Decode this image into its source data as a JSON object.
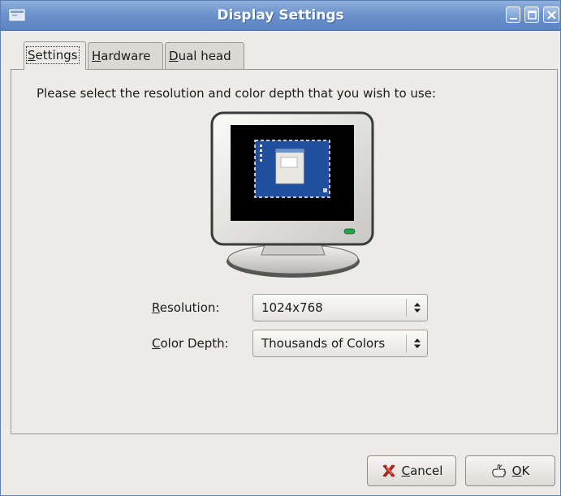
{
  "window": {
    "title": "Display Settings"
  },
  "tabs": [
    {
      "label": "Settings",
      "mnemonic": "S",
      "rest": "ettings",
      "active": true
    },
    {
      "label": "Hardware",
      "mnemonic": "H",
      "rest": "ardware",
      "active": false
    },
    {
      "label": "Dual head",
      "mnemonic": "D",
      "rest": "ual head",
      "active": false
    }
  ],
  "settings": {
    "instruction": "Please select the resolution and color depth that you wish to use:",
    "resolution": {
      "label_mnemonic": "R",
      "label_rest": "esolution:",
      "value": "1024x768"
    },
    "color_depth": {
      "label_mnemonic": "C",
      "label_rest": "olor Depth:",
      "value": "Thousands of Colors"
    }
  },
  "buttons": {
    "cancel": {
      "mnemonic": "C",
      "rest": "ancel",
      "icon": "cancel-x-icon"
    },
    "ok": {
      "mnemonic": "O",
      "rest": "K",
      "icon": "ok-hand-icon"
    }
  },
  "colors": {
    "titlebar": "#6d93cb",
    "window_bg": "#edebe8",
    "screen_blue": "#1f4f9d"
  }
}
